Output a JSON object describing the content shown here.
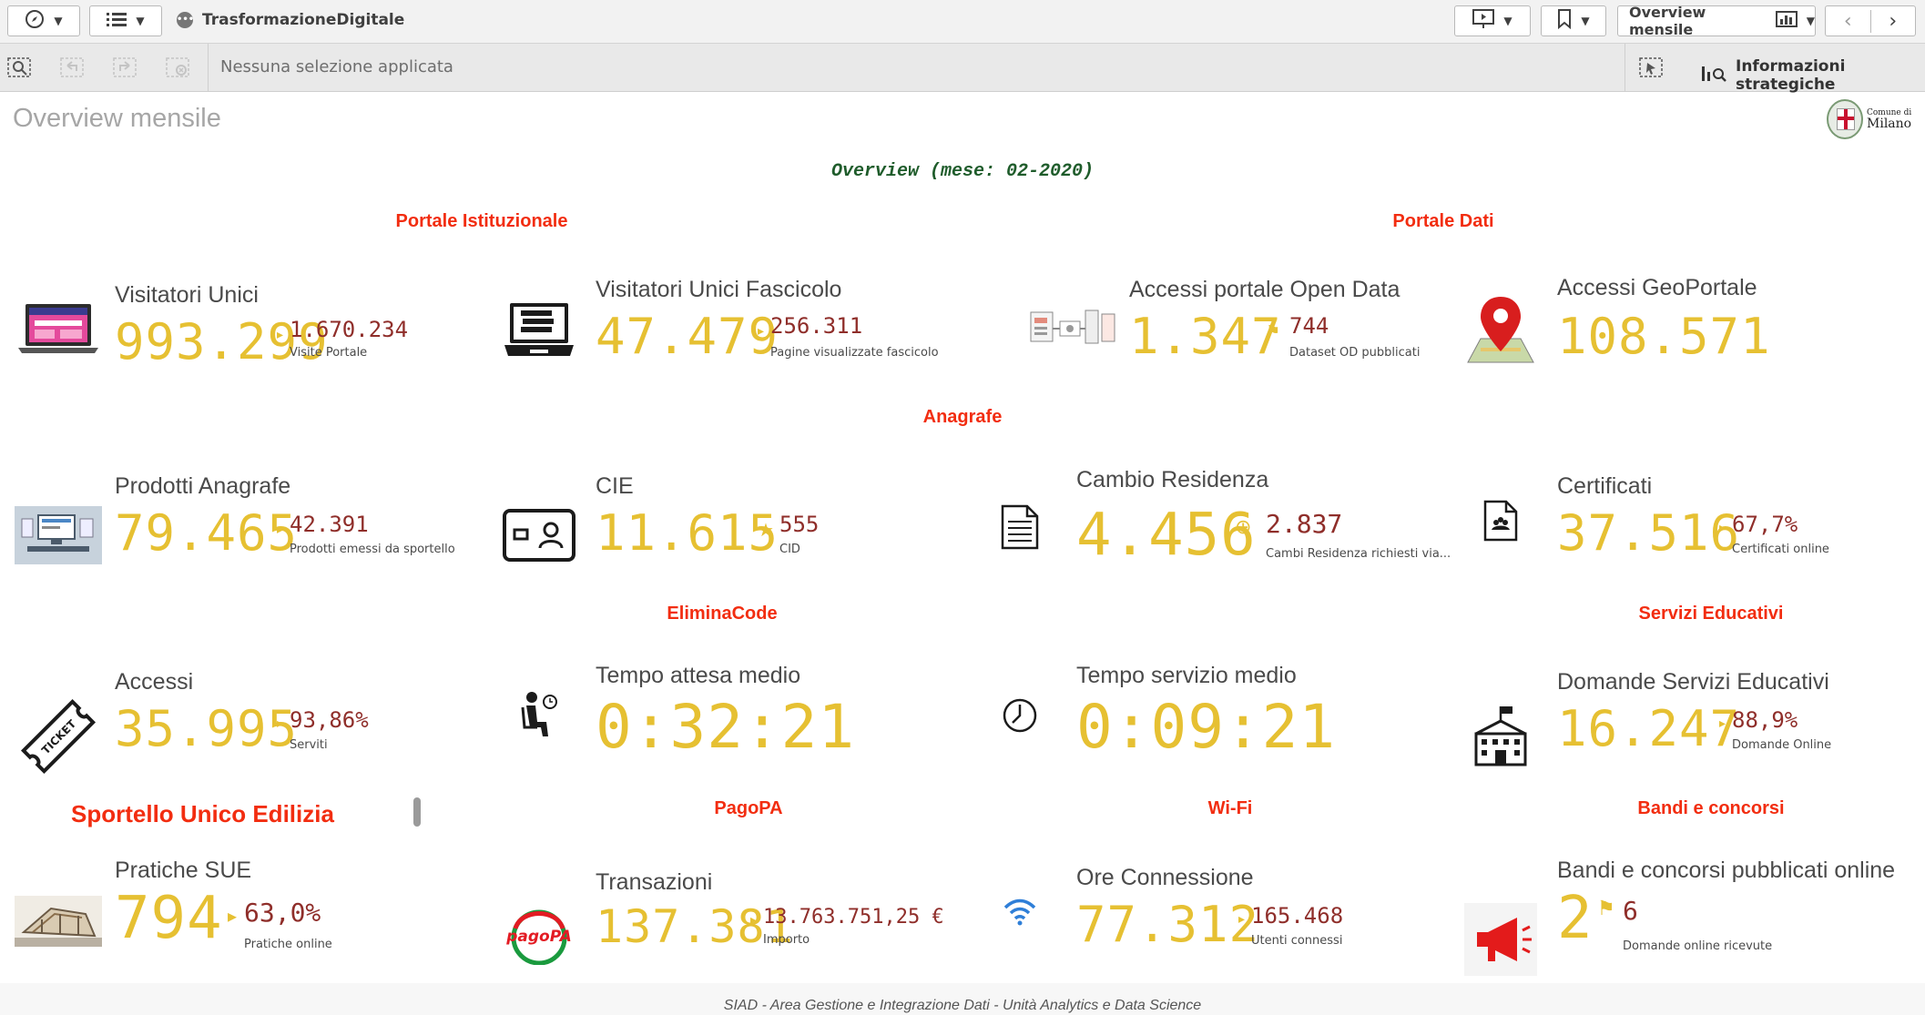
{
  "toolbar": {
    "app_name": "TrasformazioneDigitale",
    "sheet_selector": "Overview mensile"
  },
  "selection_bar": {
    "status": "Nessuna selezione applicata",
    "insights": "Informazioni strategiche"
  },
  "sheet": {
    "title": "Overview mensile",
    "logo_small": "Comune di",
    "logo_big": "Milano",
    "heading": "Overview (mese: 02-2020)",
    "footer": "SIAD - Area Gestione e Integrazione Dati - Unità Analytics e Data Science"
  },
  "sections": {
    "portale_istituzionale": "Portale Istituzionale",
    "portale_dati": "Portale Dati",
    "anagrafe": "Anagrafe",
    "eliminacode": "EliminaCode",
    "servizi_educativi": "Servizi Educativi",
    "sue": "Sportello Unico Edilizia",
    "pagopa": "PagoPA",
    "wifi": "Wi-Fi",
    "bandi": "Bandi e concorsi"
  },
  "kpis": {
    "visitatori_unici": {
      "label": "Visitatori Unici",
      "value": "993.299",
      "secondary": "1.670.234",
      "sub": "Visite Portale",
      "icon": "laptop-icon",
      "marker": "▸"
    },
    "visitatori_fascicolo": {
      "label": "Visitatori Unici Fascicolo",
      "value": "47.479",
      "secondary": "256.311",
      "sub": "Pagine visualizzate fascicolo",
      "icon": "laptop-document-icon",
      "marker": "▸"
    },
    "open_data": {
      "label": "Accessi portale Open Data",
      "value": "1.347",
      "secondary": "744",
      "sub": "Dataset OD pubblicati",
      "icon": "data-flow-icon",
      "marker": "⚑"
    },
    "geoportale": {
      "label": "Accessi GeoPortale",
      "value": "108.571",
      "icon": "map-pin-icon"
    },
    "prodotti_anagrafe": {
      "label": "Prodotti Anagrafe",
      "value": "79.465",
      "secondary": "42.391",
      "sub": "Prodotti emessi da sportello",
      "icon": "desk-terminal-icon",
      "marker": "▸"
    },
    "cie": {
      "label": "CIE",
      "value": "11.615",
      "secondary": "555",
      "sub": "CID",
      "icon": "id-card-icon",
      "marker": "★"
    },
    "cambio_residenza": {
      "label": "Cambio Residenza",
      "value": "4.456",
      "secondary": "2.837",
      "sub": "Cambi Residenza richiesti via...",
      "icon": "document-lines-icon",
      "marker": "⊕"
    },
    "certificati": {
      "label": "Certificati",
      "value": "37.516",
      "secondary": "67,7%",
      "sub": "Certificati online",
      "icon": "certificate-file-icon",
      "marker": "▸"
    },
    "accessi_code": {
      "label": "Accessi",
      "value": "35.995",
      "secondary": "93,86%",
      "sub": "Serviti",
      "icon": "ticket-icon",
      "marker": "▸"
    },
    "tempo_attesa": {
      "label": "Tempo attesa medio",
      "value": "0:32:21",
      "icon": "waiting-person-icon"
    },
    "tempo_servizio": {
      "label": "Tempo servizio medio",
      "value": "0:09:21",
      "icon": "clock-icon"
    },
    "servizi_educativi": {
      "label": "Domande Servizi Educativi",
      "value": "16.247",
      "secondary": "88,9%",
      "sub": "Domande Online",
      "icon": "school-building-icon",
      "marker": "▸"
    },
    "pratiche_sue": {
      "label": "Pratiche SUE",
      "value": "794",
      "secondary": "63,0%",
      "sub": "Pratiche online",
      "icon": "building-plan-icon",
      "marker": "▸"
    },
    "transazioni": {
      "label": "Transazioni",
      "value": "137.381",
      "secondary": "13.763.751,25 €",
      "sub": "Importo",
      "icon": "pagopa-logo-icon",
      "marker": "▸"
    },
    "ore_connessione": {
      "label": "Ore Connessione",
      "value": "77.312",
      "secondary": "165.468",
      "sub": "Utenti connessi",
      "icon": "wifi-icon",
      "marker": "▸"
    },
    "bandi": {
      "label": "Bandi e concorsi pubblicati online",
      "value": "2",
      "secondary": "6",
      "sub": "Domande online ricevute",
      "icon": "megaphone-icon",
      "marker": "⚑"
    }
  }
}
